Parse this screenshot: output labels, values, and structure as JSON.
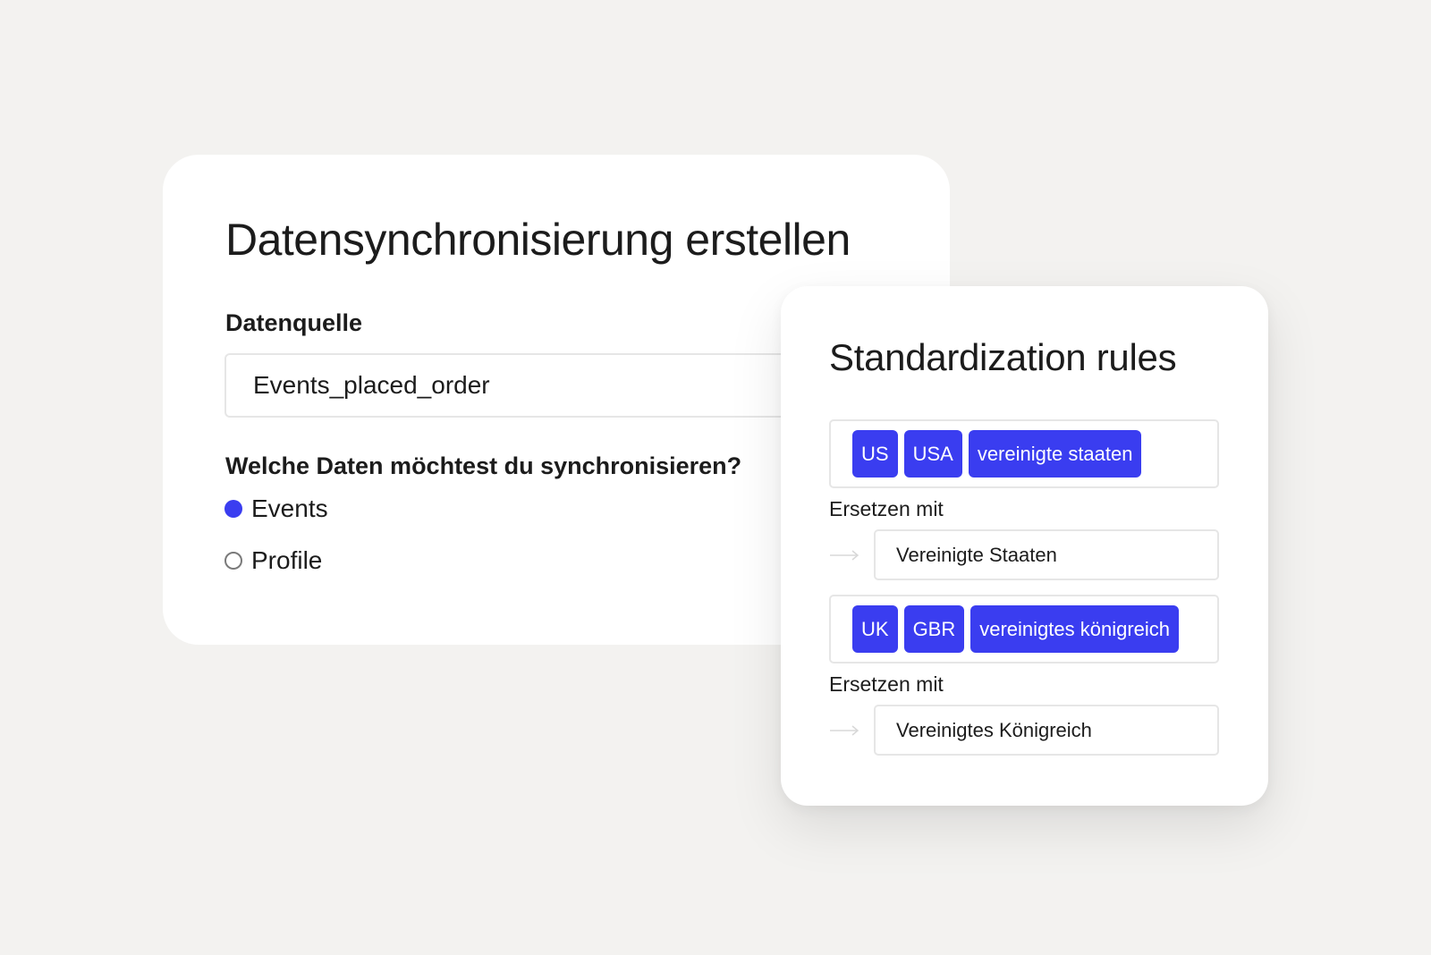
{
  "sync_card": {
    "title": "Datensynchronisierung erstellen",
    "source_label": "Datenquelle",
    "source_value": "Events_placed_order",
    "question": "Welche Daten möchtest du synchronisieren?",
    "options": [
      {
        "label": "Events",
        "selected": true
      },
      {
        "label": "Profile",
        "selected": false
      }
    ]
  },
  "rules_card": {
    "title": "Standardization rules",
    "rules": [
      {
        "tags": [
          "US",
          "USA",
          "vereinigte staaten"
        ],
        "replace_label": "Ersetzen mit",
        "replace_value": "Vereinigte Staaten"
      },
      {
        "tags": [
          "UK",
          "GBR",
          "vereinigtes königreich"
        ],
        "replace_label": "Ersetzen mit",
        "replace_value": "Vereinigtes Königreich"
      }
    ]
  },
  "colors": {
    "background": "#f3f2f0",
    "card": "#ffffff",
    "accent": "#3a3df0",
    "border": "#e6e6e6",
    "text": "#1c1c1c"
  },
  "icons": {
    "arrow": "arrow-right-icon",
    "radio_checked": "radio-checked-icon",
    "radio_unchecked": "radio-unchecked-icon"
  }
}
